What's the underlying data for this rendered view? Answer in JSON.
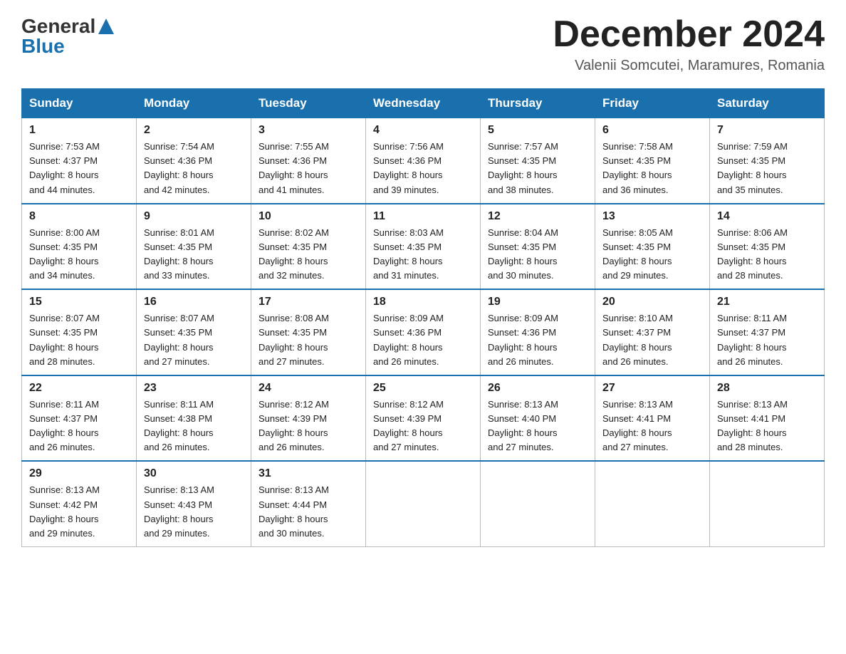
{
  "header": {
    "logo_line1": "General",
    "logo_line2": "Blue",
    "month_title": "December 2024",
    "location": "Valenii Somcutei, Maramures, Romania"
  },
  "days_of_week": [
    "Sunday",
    "Monday",
    "Tuesday",
    "Wednesday",
    "Thursday",
    "Friday",
    "Saturday"
  ],
  "weeks": [
    [
      {
        "day": "1",
        "sunrise": "7:53 AM",
        "sunset": "4:37 PM",
        "daylight": "8 hours and 44 minutes."
      },
      {
        "day": "2",
        "sunrise": "7:54 AM",
        "sunset": "4:36 PM",
        "daylight": "8 hours and 42 minutes."
      },
      {
        "day": "3",
        "sunrise": "7:55 AM",
        "sunset": "4:36 PM",
        "daylight": "8 hours and 41 minutes."
      },
      {
        "day": "4",
        "sunrise": "7:56 AM",
        "sunset": "4:36 PM",
        "daylight": "8 hours and 39 minutes."
      },
      {
        "day": "5",
        "sunrise": "7:57 AM",
        "sunset": "4:35 PM",
        "daylight": "8 hours and 38 minutes."
      },
      {
        "day": "6",
        "sunrise": "7:58 AM",
        "sunset": "4:35 PM",
        "daylight": "8 hours and 36 minutes."
      },
      {
        "day": "7",
        "sunrise": "7:59 AM",
        "sunset": "4:35 PM",
        "daylight": "8 hours and 35 minutes."
      }
    ],
    [
      {
        "day": "8",
        "sunrise": "8:00 AM",
        "sunset": "4:35 PM",
        "daylight": "8 hours and 34 minutes."
      },
      {
        "day": "9",
        "sunrise": "8:01 AM",
        "sunset": "4:35 PM",
        "daylight": "8 hours and 33 minutes."
      },
      {
        "day": "10",
        "sunrise": "8:02 AM",
        "sunset": "4:35 PM",
        "daylight": "8 hours and 32 minutes."
      },
      {
        "day": "11",
        "sunrise": "8:03 AM",
        "sunset": "4:35 PM",
        "daylight": "8 hours and 31 minutes."
      },
      {
        "day": "12",
        "sunrise": "8:04 AM",
        "sunset": "4:35 PM",
        "daylight": "8 hours and 30 minutes."
      },
      {
        "day": "13",
        "sunrise": "8:05 AM",
        "sunset": "4:35 PM",
        "daylight": "8 hours and 29 minutes."
      },
      {
        "day": "14",
        "sunrise": "8:06 AM",
        "sunset": "4:35 PM",
        "daylight": "8 hours and 28 minutes."
      }
    ],
    [
      {
        "day": "15",
        "sunrise": "8:07 AM",
        "sunset": "4:35 PM",
        "daylight": "8 hours and 28 minutes."
      },
      {
        "day": "16",
        "sunrise": "8:07 AM",
        "sunset": "4:35 PM",
        "daylight": "8 hours and 27 minutes."
      },
      {
        "day": "17",
        "sunrise": "8:08 AM",
        "sunset": "4:35 PM",
        "daylight": "8 hours and 27 minutes."
      },
      {
        "day": "18",
        "sunrise": "8:09 AM",
        "sunset": "4:36 PM",
        "daylight": "8 hours and 26 minutes."
      },
      {
        "day": "19",
        "sunrise": "8:09 AM",
        "sunset": "4:36 PM",
        "daylight": "8 hours and 26 minutes."
      },
      {
        "day": "20",
        "sunrise": "8:10 AM",
        "sunset": "4:37 PM",
        "daylight": "8 hours and 26 minutes."
      },
      {
        "day": "21",
        "sunrise": "8:11 AM",
        "sunset": "4:37 PM",
        "daylight": "8 hours and 26 minutes."
      }
    ],
    [
      {
        "day": "22",
        "sunrise": "8:11 AM",
        "sunset": "4:37 PM",
        "daylight": "8 hours and 26 minutes."
      },
      {
        "day": "23",
        "sunrise": "8:11 AM",
        "sunset": "4:38 PM",
        "daylight": "8 hours and 26 minutes."
      },
      {
        "day": "24",
        "sunrise": "8:12 AM",
        "sunset": "4:39 PM",
        "daylight": "8 hours and 26 minutes."
      },
      {
        "day": "25",
        "sunrise": "8:12 AM",
        "sunset": "4:39 PM",
        "daylight": "8 hours and 27 minutes."
      },
      {
        "day": "26",
        "sunrise": "8:13 AM",
        "sunset": "4:40 PM",
        "daylight": "8 hours and 27 minutes."
      },
      {
        "day": "27",
        "sunrise": "8:13 AM",
        "sunset": "4:41 PM",
        "daylight": "8 hours and 27 minutes."
      },
      {
        "day": "28",
        "sunrise": "8:13 AM",
        "sunset": "4:41 PM",
        "daylight": "8 hours and 28 minutes."
      }
    ],
    [
      {
        "day": "29",
        "sunrise": "8:13 AM",
        "sunset": "4:42 PM",
        "daylight": "8 hours and 29 minutes."
      },
      {
        "day": "30",
        "sunrise": "8:13 AM",
        "sunset": "4:43 PM",
        "daylight": "8 hours and 29 minutes."
      },
      {
        "day": "31",
        "sunrise": "8:13 AM",
        "sunset": "4:44 PM",
        "daylight": "8 hours and 30 minutes."
      },
      null,
      null,
      null,
      null
    ]
  ],
  "labels": {
    "sunrise": "Sunrise:",
    "sunset": "Sunset:",
    "daylight": "Daylight:"
  }
}
